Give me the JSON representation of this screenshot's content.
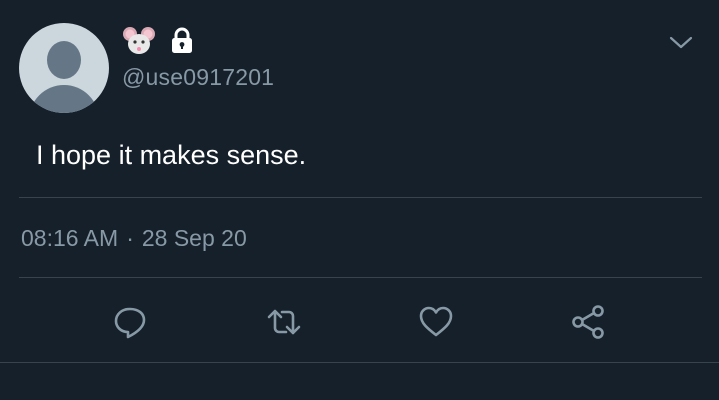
{
  "tweet": {
    "handle": "@use0917201",
    "text": "I hope it makes sense.",
    "time": "08:16 AM",
    "separator": "·",
    "date": "28 Sep 20"
  },
  "icons": {
    "name_emoji": "mouse-face-icon",
    "protected": "lock-icon",
    "menu": "chevron-down-icon",
    "reply": "reply-icon",
    "retweet": "retweet-icon",
    "like": "heart-icon",
    "share": "share-icon"
  },
  "colors": {
    "background": "#15202b",
    "secondary_text": "#8899a6",
    "divider": "#38444d"
  }
}
